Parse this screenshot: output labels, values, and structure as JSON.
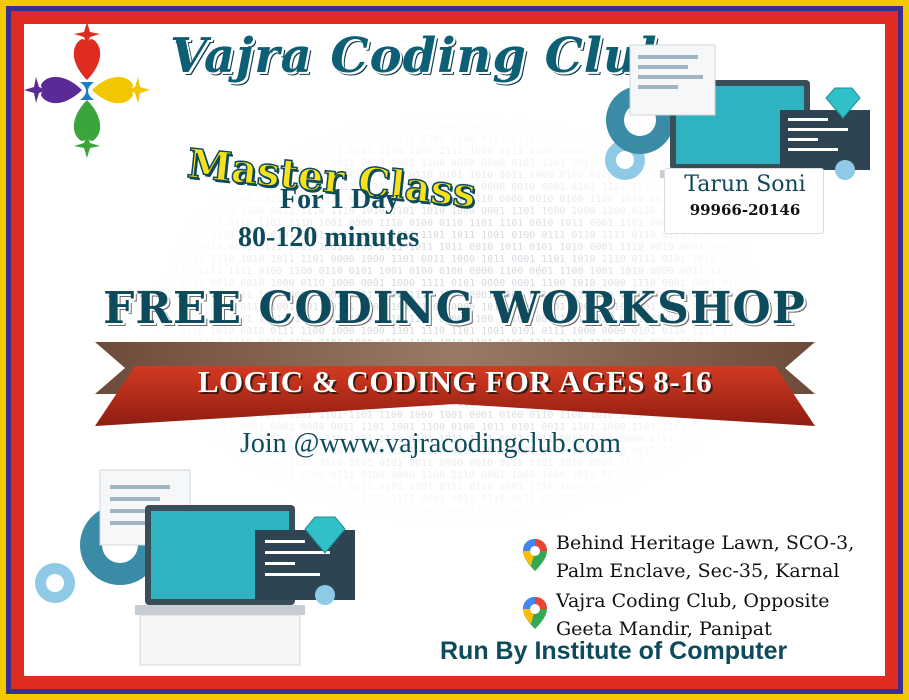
{
  "poster": {
    "club_name": "Vajra Coding Club",
    "master_class": "Master Class",
    "duration_days": "For 1 Day",
    "duration_minutes": "80-120 minutes",
    "headline": "FREE CODING WORKSHOP",
    "ribbon_text": "LOGIC & CODING FOR AGES 8-16",
    "join_text": "Join @www.vajracodingclub.com",
    "run_by": "Run By Institute of Computer"
  },
  "contact": {
    "name": "Tarun Soni",
    "phone": "99966-20146"
  },
  "locations": [
    {
      "line1": "Behind Heritage Lawn, SCO-3,",
      "line2": "Palm Enclave, Sec-35, Karnal"
    },
    {
      "line1": "Vajra Coding Club, Opposite",
      "line2": "Geeta Mandir, Panipat"
    }
  ],
  "icons": {
    "logo": "vajra-logo-icon",
    "pin": "map-pin-icon",
    "laptop": "laptop-code-icon",
    "gear": "gear-icon",
    "diamond": "diamond-icon"
  },
  "colors": {
    "frame_yellow": "#f2c700",
    "frame_blue": "#3b2e8f",
    "frame_red": "#e02b20",
    "title_teal": "#0d5f75",
    "master_yellow": "#f7e01c",
    "ribbon_red": "#b3271a"
  }
}
